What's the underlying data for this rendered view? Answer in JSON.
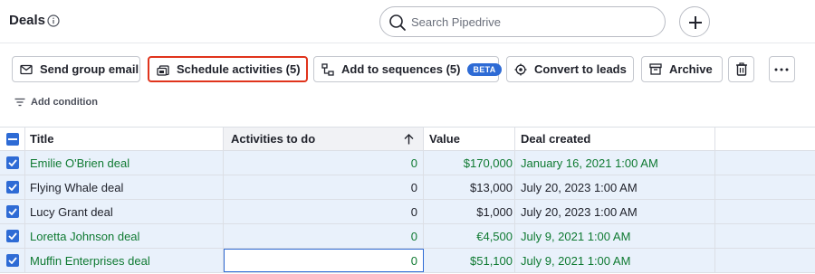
{
  "header": {
    "title": "Deals",
    "search_placeholder": "Search Pipedrive",
    "add_icon": "plus-icon"
  },
  "toolbar": {
    "send_group_email": "Send group email",
    "schedule_activities": "Schedule activities (5)",
    "add_to_sequences": "Add to sequences (5)",
    "beta_badge": "BETA",
    "convert_to_leads": "Convert to leads",
    "archive": "Archive",
    "highlight_color": "#e0341c"
  },
  "filter": {
    "add_condition": "Add condition"
  },
  "table": {
    "columns": [
      "Title",
      "Activities to do",
      "Value",
      "Deal created"
    ],
    "sort_indicator": "arrow-up-icon",
    "rows": [
      {
        "title": "Emilie O'Brien deal",
        "activities": "0",
        "value": "$170,000",
        "created": "January 16, 2021 1:00 AM",
        "highlight": true
      },
      {
        "title": "Flying Whale deal",
        "activities": "0",
        "value": "$13,000",
        "created": "July 20, 2023 1:00 AM",
        "highlight": false
      },
      {
        "title": "Lucy Grant deal",
        "activities": "0",
        "value": "$1,000",
        "created": "July 20, 2023 1:00 AM",
        "highlight": false
      },
      {
        "title": "Loretta Johnson deal",
        "activities": "0",
        "value": "€4,500",
        "created": "July 9, 2021 1:00 AM",
        "highlight": true
      },
      {
        "title": "Muffin Enterprises deal",
        "activities": "0",
        "value": "$51,100",
        "created": "July 9, 2021 1:00 AM",
        "highlight": true
      }
    ]
  },
  "colors": {
    "accent": "#2e6bd5",
    "highlight_text": "#0f7a32",
    "row_selected_bg": "#e9f1fb"
  }
}
